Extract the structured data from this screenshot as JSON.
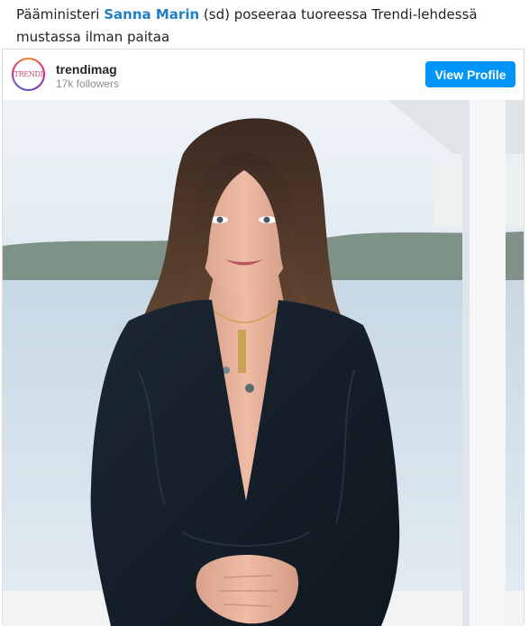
{
  "headline": {
    "prefix": "Pääministeri ",
    "name": "Sanna Marin",
    "suffix": " (sd) poseeraa tuoreessa Trendi-lehdessä mustassa ilman paitaa"
  },
  "embed": {
    "avatar_text": "TRENDI",
    "username": "trendimag",
    "followers": "17k followers",
    "view_profile_label": "View Profile"
  },
  "colors": {
    "link": "#1f7fc4",
    "button": "#0095f6"
  },
  "icons": {
    "avatar": "trendi-logo-icon"
  }
}
